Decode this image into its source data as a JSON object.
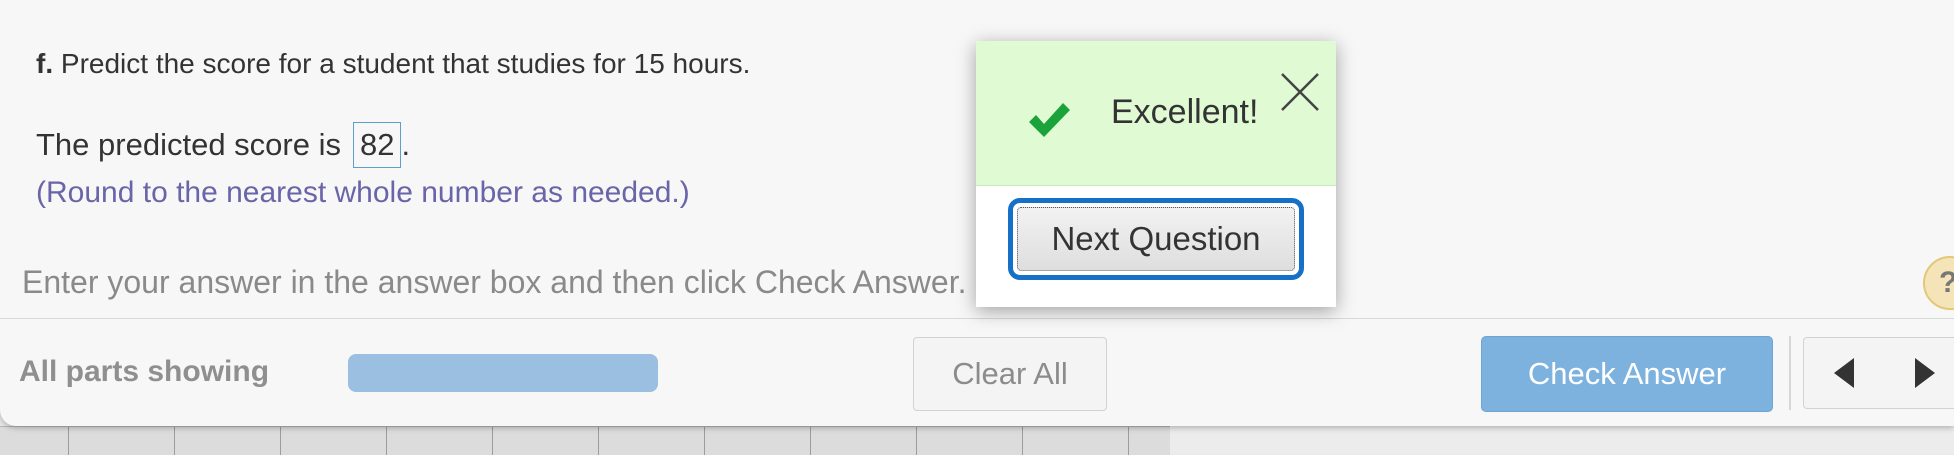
{
  "question": {
    "part_label": "f.",
    "text": "Predict the score for a student that studies for 15 hours."
  },
  "answer": {
    "prefix": "The predicted score is",
    "value": "82",
    "suffix": ".",
    "hint": "(Round to the nearest whole number as needed.)"
  },
  "instructions": "Enter your answer in the answer box and then click Check Answer.",
  "help": {
    "label": "?"
  },
  "footer": {
    "parts_label": "All parts showing",
    "progress_fraction": 1.0,
    "clear_all_label": "Clear All",
    "check_answer_label": "Check Answer"
  },
  "feedback": {
    "message": "Excellent!",
    "next_label": "Next Question",
    "success_color": "#1aa33a"
  },
  "icons": {
    "success": "checkmark-icon",
    "close": "close-icon",
    "prev": "triangle-left-icon",
    "next": "triangle-right-icon"
  },
  "colors": {
    "accent_blue": "#1770c8",
    "check_button": "#7db2de",
    "feedback_bg": "#e0fad4",
    "hint_text": "#6a64a8"
  }
}
